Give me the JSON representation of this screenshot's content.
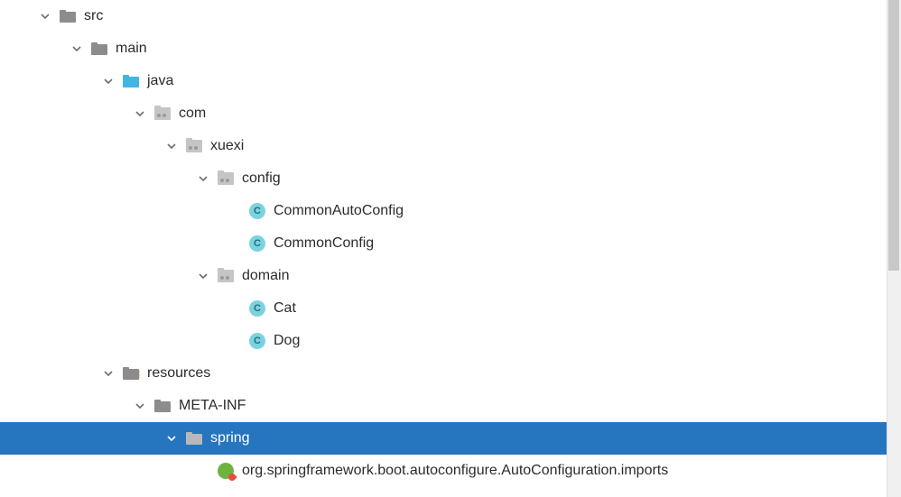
{
  "tree": {
    "src": "src",
    "main": "main",
    "java": "java",
    "com": "com",
    "xuexi": "xuexi",
    "config": "config",
    "CommonAutoConfig": "CommonAutoConfig",
    "CommonConfig": "CommonConfig",
    "domain": "domain",
    "Cat": "Cat",
    "Dog": "Dog",
    "resources": "resources",
    "META_INF": "META-INF",
    "spring": "spring",
    "imports_file": "org.springframework.boot.autoconfigure.AutoConfiguration.imports"
  },
  "class_icon_letter": "C",
  "colors": {
    "selection_bg": "#2675bf",
    "folder_gray": "#8c8c8c",
    "folder_blue": "#40b6e0",
    "class_bg": "#7bd3e0",
    "spring_green": "#6db33f"
  }
}
